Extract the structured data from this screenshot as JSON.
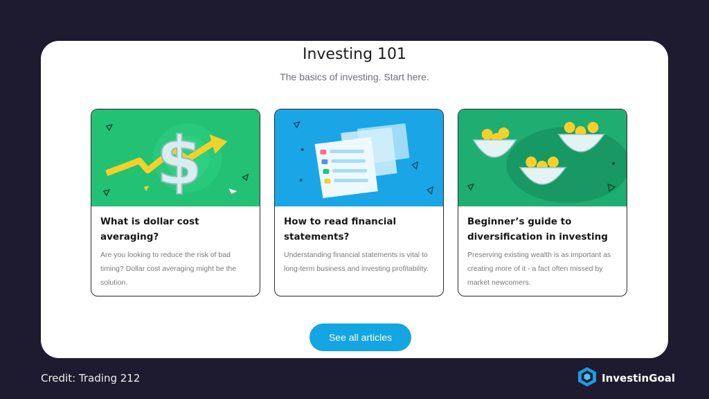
{
  "header": {
    "title": "Investing 101",
    "subtitle": "The basics of investing. Start here."
  },
  "cards": [
    {
      "title": "What is dollar cost averaging?",
      "description": "Are you looking to reduce the risk of bad timing? Dollar cost averaging might be the solution.",
      "image_bg": "#22c173"
    },
    {
      "title": "How to read financial statements?",
      "description": "Understanding financial statements is vital to long-term business and investing profitability.",
      "image_bg": "#1aa6e6"
    },
    {
      "title": "Beginner’s guide to diversification in investing",
      "description": "Preserving existing wealth is as important as creating more of it - a fact often missed by market newcomers.",
      "image_bg": "#1fae72"
    }
  ],
  "cta": {
    "label": "See all articles"
  },
  "footer": {
    "credit": "Credit: Trading 212",
    "brand": "InvestinGoal"
  },
  "colors": {
    "background": "#1e1a30",
    "panel": "#ffffff",
    "accent": "#14a5e3"
  }
}
